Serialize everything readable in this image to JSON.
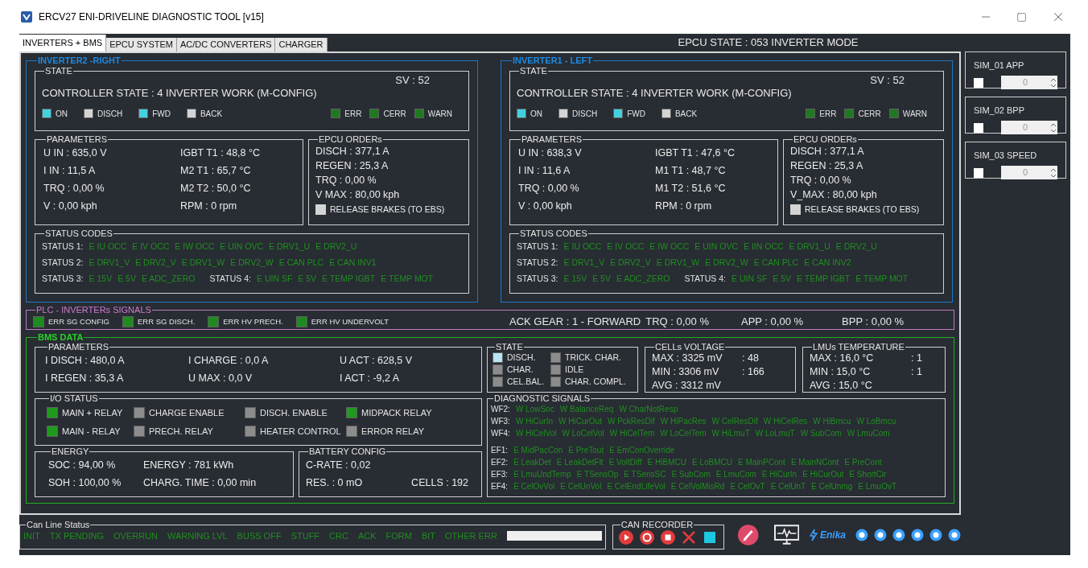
{
  "window": {
    "title": "ERCV27 ENI-DRIVELINE DIAGNOSTIC TOOL [v15]"
  },
  "tabs": [
    {
      "label": "INVERTERS + BMS",
      "selected": true
    },
    {
      "label": "EPCU SYSTEM",
      "selected": false
    },
    {
      "label": "AC/DC CONVERTERS",
      "selected": false
    },
    {
      "label": "CHARGER",
      "selected": false
    }
  ],
  "epcu_state": "EPCU STATE : 053 INVERTER MODE",
  "inverters": [
    {
      "title": "INVERTER2 -RIGHT",
      "state": {
        "title": "STATE",
        "controller": "CONTROLLER STATE : 4 INVERTER WORK (M-CONFIG)",
        "sv": "SV : 52",
        "flags": [
          {
            "label": "ON",
            "color": "#45d0e0"
          },
          {
            "label": "DISCH",
            "color": "#d4d4d4"
          },
          {
            "label": "FWD",
            "color": "#45d0e0"
          },
          {
            "label": "BACK",
            "color": "#d4d4d4"
          }
        ],
        "leds": [
          {
            "label": "ERR",
            "color": "#1f7a1f"
          },
          {
            "label": "CERR",
            "color": "#1f7a1f"
          },
          {
            "label": "WARN",
            "color": "#1f7a1f"
          }
        ]
      },
      "parameters": {
        "title": "PARAMETERS",
        "rows": [
          [
            "U IN : 635,0 V",
            "IGBT T1 : 48,8 °C"
          ],
          [
            "I IN : 11,5 A",
            "M2 T1 : 65,7 °C"
          ],
          [
            "TRQ : 0,00 %",
            "M2 T2 : 50,0 °C"
          ],
          [
            "V : 0,00 kph",
            "RPM : 0 rpm"
          ]
        ]
      },
      "orders": {
        "title": "EPCU ORDERs",
        "lines": [
          "DISCH : 377,1 A",
          "REGEN : 25,3 A",
          "TRQ : 0,00 %",
          "V MAX : 80,00 kph"
        ],
        "checkbox": {
          "label": "RELEASE BRAKES (TO EBS)",
          "checked": false
        }
      },
      "status": {
        "title": "STATUS CODES",
        "rows": [
          [
            {
              "label": "STATUS 1:",
              "codes": [
                "E IU OCC",
                "E IV OCC",
                "E IW OCC",
                "E UIN OVC",
                "E DRV1_U",
                "E DRV2_U"
              ]
            }
          ],
          [
            {
              "label": "STATUS 2:",
              "codes": [
                "E DRV1_V",
                "E DRV2_V",
                "E DRV1_W",
                "E DRV2_W",
                "E CAN PLC",
                "E CAN INV1"
              ]
            }
          ],
          [
            {
              "label": "STATUS 3:",
              "codes": [
                "E 15V",
                "E 5V",
                "E ADC_ZERO"
              ]
            },
            {
              "label": "STATUS 4:",
              "codes": [
                "E UIN SF",
                "E 5V",
                "E TEMP IGBT",
                "E TEMP MOT"
              ]
            }
          ]
        ]
      }
    },
    {
      "title": "INVERTER1 - LEFT",
      "state": {
        "title": "STATE",
        "controller": "CONTROLLER STATE : 4 INVERTER WORK (M-CONFIG)",
        "sv": "SV : 52",
        "flags": [
          {
            "label": "ON",
            "color": "#45d0e0"
          },
          {
            "label": "DISCH",
            "color": "#d4d4d4"
          },
          {
            "label": "FWD",
            "color": "#45d0e0"
          },
          {
            "label": "BACK",
            "color": "#d4d4d4"
          }
        ],
        "leds": [
          {
            "label": "ERR",
            "color": "#1f7a1f"
          },
          {
            "label": "CERR",
            "color": "#1f7a1f"
          },
          {
            "label": "WARN",
            "color": "#1f7a1f"
          }
        ]
      },
      "parameters": {
        "title": "PARAMETERS",
        "rows": [
          [
            "U IN : 638,3 V",
            "IGBT T1 : 47,6 °C"
          ],
          [
            "I IN : 11,6 A",
            "M1 T1 : 48,7 °C"
          ],
          [
            "TRQ : 0,00 %",
            "M1 T2 : 51,6 °C"
          ],
          [
            "V : 0,00 kph",
            "RPM : 0 rpm"
          ]
        ]
      },
      "orders": {
        "title": "EPCU ORDERs",
        "lines": [
          "DISCH : 377,1 A",
          "REGEN : 25,3 A",
          "TRQ : 0,00 %",
          "V_MAX : 80,00 kph"
        ],
        "checkbox": {
          "label": "RELEASE BRAKES (TO EBS)",
          "checked": false
        }
      },
      "status": {
        "title": "STATUS CODES",
        "rows": [
          [
            {
              "label": "STATUS 1:",
              "codes": [
                "E IU OCC",
                "E IV OCC",
                "E IW OCC",
                "E UIN OVC",
                "E IIN OCC",
                "E DRV1_U",
                "E DRV2_U"
              ]
            }
          ],
          [
            {
              "label": "STATUS 2:",
              "codes": [
                "E DRV1_V",
                "E DRV2_V",
                "E DRV1_W",
                "E DRV2_W",
                "E CAN PLC",
                "E CAN INV2"
              ]
            }
          ],
          [
            {
              "label": "STATUS 3:",
              "codes": [
                "E 15V",
                "E 5V",
                "E ADC_ZERO"
              ]
            },
            {
              "label": "STATUS 4:",
              "codes": [
                "E UIN SF",
                "E 5V",
                "E TEMP IGBT",
                "E TEMP MOT"
              ]
            }
          ]
        ]
      }
    }
  ],
  "plc": {
    "title": "PLC - INVERTERs SIGNALS",
    "leds": [
      {
        "label": "ERR SG CONFIG",
        "color": "#1f8a1f"
      },
      {
        "label": "ERR SG DISCH.",
        "color": "#1f8a1f"
      },
      {
        "label": "ERR HV PRECH.",
        "color": "#1f8a1f"
      },
      {
        "label": "ERR HV UNDERVOLT",
        "color": "#1f8a1f"
      }
    ],
    "readings": [
      "ACK GEAR : 1 - FORWARD",
      "TRQ : 0,00 %",
      "APP : 0,00 %",
      "BPP : 0,00 %"
    ]
  },
  "bms": {
    "title": "BMS DATA",
    "parameters": {
      "title": "PARAMETERS",
      "rows": [
        [
          "I DISCH : 480,0 A",
          "I CHARGE : 0,0 A",
          "U ACT : 628,5 V"
        ],
        [
          "I REGEN : 35,3 A",
          "U MAX : 0,0 V",
          "I ACT : -9,2 A"
        ]
      ]
    },
    "io_status": {
      "title": "I/O STATUS",
      "leds": [
        {
          "label": "MAIN + RELAY",
          "color": "#1f9a1f"
        },
        {
          "label": "CHARGE ENABLE",
          "color": "#8c8c8c"
        },
        {
          "label": "DISCH. ENABLE",
          "color": "#8c8c8c"
        },
        {
          "label": "MIDPACK RELAY",
          "color": "#1f9a1f"
        },
        {
          "label": "MAIN - RELAY",
          "color": "#1f9a1f"
        },
        {
          "label": "PRECH. RELAY",
          "color": "#8c8c8c"
        },
        {
          "label": "HEATER CONTROL",
          "color": "#8c8c8c"
        },
        {
          "label": "ERROR RELAY",
          "color": "#8c8c8c"
        }
      ]
    },
    "energy": {
      "title": "ENERGY",
      "rows": [
        [
          "SOC : 94,00 %",
          "ENERGY : 781 kWh"
        ],
        [
          "SOH : 100,00 %",
          "CHARG. TIME : 0,00 min"
        ]
      ]
    },
    "battery_config": {
      "title": "BATTERY CONFIG",
      "rows": [
        [
          "C-RATE : 0,02"
        ],
        [
          "RES. : 0 mO",
          "CELLS : 192"
        ]
      ]
    },
    "state": {
      "title": "STATE",
      "leds": [
        {
          "label": "DISCH.",
          "color": "#b8e4f4"
        },
        {
          "label": "TRICK. CHAR.",
          "color": "#8c8c8c"
        },
        {
          "label": "CHAR.",
          "color": "#8c8c8c"
        },
        {
          "label": "IDLE",
          "color": "#8c8c8c"
        },
        {
          "label": "CEL.BAL.",
          "color": "#8c8c8c"
        },
        {
          "label": "CHAR. COMPL.",
          "color": "#8c8c8c"
        }
      ]
    },
    "cells_voltage": {
      "title": "CELLs VOLTAGE",
      "rows": [
        [
          "MAX : 3325 mV",
          ": 48"
        ],
        [
          "MIN : 3306 mV",
          ": 166"
        ],
        [
          "AVG : 3312 mV"
        ]
      ]
    },
    "lmu_temperature": {
      "title": "LMUs TEMPERATURE",
      "rows": [
        [
          "MAX : 16,0 °C",
          ": 1"
        ],
        [
          "MIN : 15,0 °C",
          ": 1"
        ],
        [
          "AVG : 15,0 °C"
        ]
      ]
    },
    "diagnostic": {
      "title": "DIAGNOSTIC SIGNALS",
      "groups": [
        [
          {
            "label": "WF2:",
            "codes": [
              "W LowSoc",
              "W BalanceReq",
              "W CharNotResp"
            ]
          },
          {
            "label": "WF3:",
            "codes": [
              "W HiCurIn",
              "W HiCurOut",
              "W PckResDif",
              "W HiPacRes",
              "W CelResDif",
              "W HiCelRes",
              "W HiBmcu",
              "W LoBmcu"
            ]
          },
          {
            "label": "WF4:",
            "codes": [
              "W HiCelVol",
              "W LoCelVol",
              "W HiCelTem",
              "W LoCelTem",
              "W HiLmuT",
              "W LoLmuT",
              "W SubCom",
              "W LmuCom"
            ]
          }
        ],
        [
          {
            "label": "EF1:",
            "codes": [
              "E MidPacCon",
              "E PreTout",
              "E EmConOverride"
            ]
          },
          {
            "label": "EF2:",
            "codes": [
              "E LeakDet",
              "E LeakDetFlt",
              "E VoltDiff",
              "E HiBMCU",
              "E LoBMCU",
              "E MainPCont",
              "E MainNCont",
              "E PreCont"
            ]
          },
          {
            "label": "EF3:",
            "codes": [
              "E LmuUndTemp",
              "E TSensOp",
              "E TSensSC",
              "E SubCom",
              "E LmuCom",
              "E HiCurIn",
              "E HiCurOut",
              "E ShortCir"
            ]
          },
          {
            "label": "EF4:",
            "codes": [
              "E CelOvVol",
              "E CelUnVol",
              "E CelEndLifeVol",
              "E CelVolMisRd",
              "E CelOvT",
              "E CelUnT",
              "E CelUnmg",
              "E LmuOvT"
            ]
          }
        ]
      ]
    }
  },
  "can_line": {
    "title": "Can Line Status",
    "flags": [
      "INIT",
      "TX PENDING",
      "OVERRUN",
      "WARNING LVL",
      "BUSS OFF",
      "STUFF",
      "CRC",
      "ACK",
      "FORM",
      "BIT",
      "OTHER ERR"
    ]
  },
  "can_recorder": {
    "title": "CAN RECORDER"
  },
  "logo": "Enika",
  "sims": [
    {
      "label": "SIM_01 APP",
      "checked": false,
      "value": "0"
    },
    {
      "label": "SIM_02 BPP",
      "checked": false,
      "value": "0"
    },
    {
      "label": "SIM_03 SPEED",
      "checked": false,
      "value": "0"
    }
  ]
}
